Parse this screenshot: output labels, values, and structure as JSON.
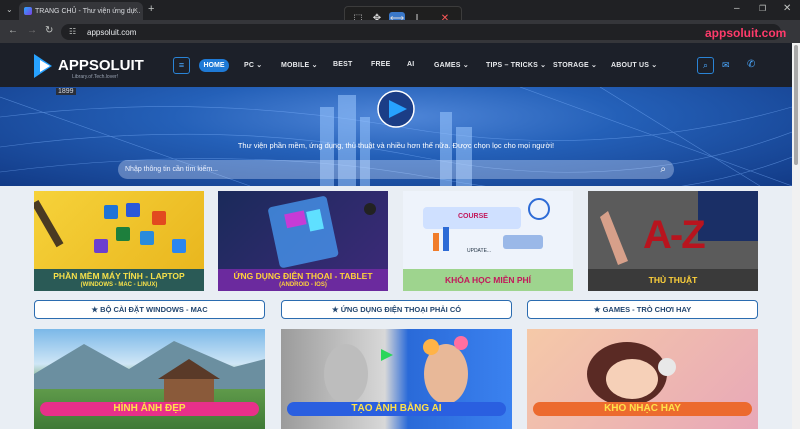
{
  "browser": {
    "tab_title": "TRANG CHỦ - Thư viện ứng dụ...",
    "url": "appsoluit.com",
    "watermark": "appsoluit.com"
  },
  "site": {
    "logo_text": "APPSOLUIT",
    "logo_tagline": "Library.of.Tech.lover!",
    "nav": [
      {
        "label": "HOME"
      },
      {
        "label": "PC"
      },
      {
        "label": "MOBILE"
      },
      {
        "label": "BEST"
      },
      {
        "label": "FREE"
      },
      {
        "label": "AI"
      },
      {
        "label": "GAMES"
      },
      {
        "label": "TIPS – TRICKS"
      },
      {
        "label": "STORAGE"
      },
      {
        "label": "ABOUT US"
      }
    ],
    "tooltip_number": "1899"
  },
  "hero": {
    "tagline": "Thư viện phần mềm, ứng dụng, thủ thuật và nhiều hơn thế nữa. Được chọn lọc cho mọi người!",
    "search_placeholder": "Nhập thông tin cần tìm kiếm..."
  },
  "cards": [
    {
      "title": "PHẦN MỀM MÁY TÍNH - LAPTOP",
      "subtitle": "(WINDOWS - MAC - LINUX)"
    },
    {
      "title": "ỨNG DỤNG ĐIỆN THOẠI - TABLET",
      "subtitle": "(ANDROID - IOS)"
    },
    {
      "title": "KHÓA HỌC MIỄN PHÍ",
      "subtitle": "",
      "course_tag": "COURSE",
      "update_tag": "UPDATE..."
    },
    {
      "title": "THỦ THUẬT",
      "subtitle": "",
      "az_text": "A-Z"
    }
  ],
  "pills": [
    {
      "label": "BỘ CÀI ĐẶT WINDOWS - MAC"
    },
    {
      "label": "ỨNG DỤNG ĐIỆN THOẠI PHẢI CÓ"
    },
    {
      "label": "GAMES - TRÒ CHƠI HAY"
    }
  ],
  "banners": [
    {
      "label": "HÌNH ẢNH ĐẸP",
      "color": "#e8308a"
    },
    {
      "label": "TẠO ẢNH BẰNG AI",
      "color": "#2a5fe0"
    },
    {
      "label": "KHO NHẠC HAY",
      "color": "#ec6a2e"
    }
  ],
  "colors": {
    "accent": "#1f7ad6",
    "header_bg": "#1c2029"
  }
}
